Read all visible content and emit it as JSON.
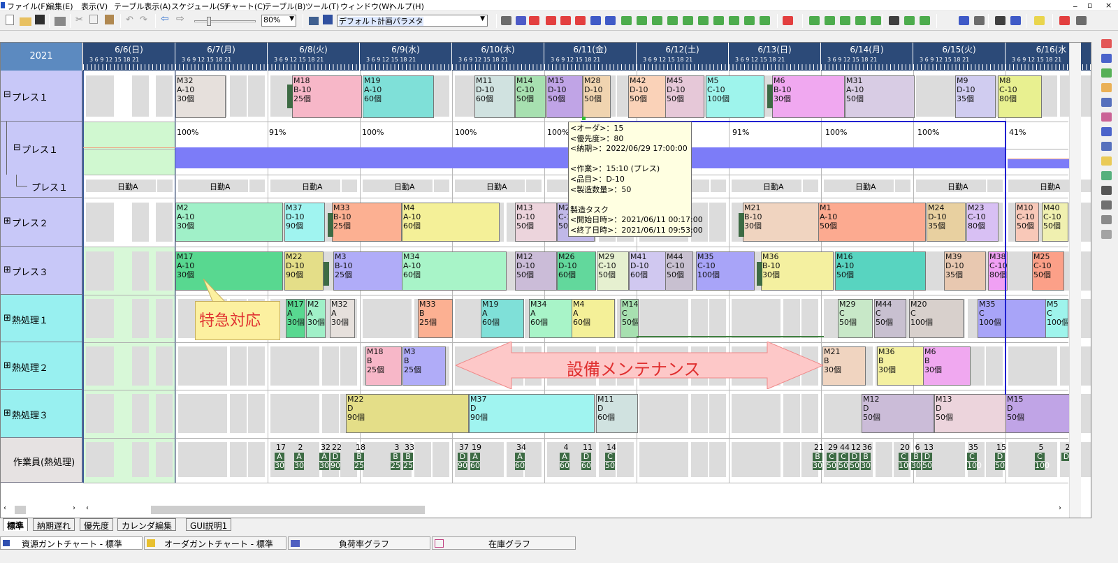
{
  "menu": [
    "ファイル(F)",
    "編集(E)",
    "表示(V)",
    "テーブル表示(A)",
    "スケジュール(S)",
    "チャート(C)",
    "テーブル(B)",
    "ツール(T)",
    "ウィンドウ(W)",
    "ヘルプ(H)"
  ],
  "window_controls": [
    "_",
    "▫",
    "×"
  ],
  "toolbar": {
    "zoom": "80%",
    "param_select": "デフォルト計画パラメタ"
  },
  "chart": {
    "year": "2021",
    "dates": [
      "6/6(日)",
      "6/7(月)",
      "6/8(火)",
      "6/9(水)",
      "6/10(木)",
      "6/11(金)",
      "6/12(土)",
      "6/13(日)",
      "6/14(月)",
      "6/15(火)",
      "6/16(水"
    ],
    "hours": "3  6  9  12  15  18  21",
    "rows": [
      "プレス１",
      "プレス１",
      "プレス１",
      "プレス２",
      "プレス３",
      "熱処理１",
      "熱処理２",
      "熱処理３",
      "作業員(熱処理)"
    ],
    "rows_prefix": [
      "⊟",
      "⊟",
      "",
      "⊞",
      "⊞",
      "⊞",
      "⊞",
      "⊞",
      ""
    ],
    "percents": [
      "100%",
      "91%",
      "100%",
      "100%",
      "100%",
      "91%",
      "100%",
      "100%",
      "41%"
    ],
    "calendar": [
      "日勤A",
      "日勤A",
      "日勤A",
      "日勤A",
      "日勤A",
      "日勤A",
      "日勤A",
      "日勤A",
      "日勤A",
      "日勤A",
      "日勤A"
    ]
  },
  "press1_bars": [
    {
      "t": "M32\nA-10\n30個",
      "c": "#e6e0dc"
    },
    {
      "t": "M18\nB-10\n25個",
      "c": "#f7b7c8"
    },
    {
      "t": "M19\nA-10\n60個",
      "c": "#7fe0d8"
    },
    {
      "t": "M11\nD-10\n60個",
      "c": "#d0e2e0"
    },
    {
      "t": "M14\nC-10\n50個",
      "c": "#a7e0b0"
    },
    {
      "t": "M15\nD-10\n50個",
      "c": "#c0a4e6"
    },
    {
      "t": "M28\nD-10\n50個",
      "c": "#f0d4b0"
    },
    {
      "t": "M42\nD-10\n50個",
      "c": "#fad2b8"
    },
    {
      "t": "M45\nD-10\n50個",
      "c": "#e6c8d8"
    },
    {
      "t": "M5\nC-10\n100個",
      "c": "#9ef4ec"
    },
    {
      "t": "M6\nB-10\n30個",
      "c": "#f0a8f0"
    },
    {
      "t": "M31\nA-10\n50個",
      "c": "#d8cce4"
    },
    {
      "t": "M9\nD-10\n35個",
      "c": "#d0ccf0"
    },
    {
      "t": "M8\nC-10\n80個",
      "c": "#e8f090"
    }
  ],
  "press2_bars": [
    {
      "t": "M2\nA-10\n30個",
      "c": "#a0f0c8"
    },
    {
      "t": "M37\nD-10\n90個",
      "c": "#a0f4f0"
    },
    {
      "t": "M33\nB-10\n25個",
      "c": "#fcb092"
    },
    {
      "t": "M4\nA-10\n60個",
      "c": "#f4f098"
    },
    {
      "t": "M13\nD-10\n50個",
      "c": "#ecd4dc"
    },
    {
      "t": "M27\nC-10\n50個",
      "c": "#c0b8e8"
    },
    {
      "t": "M21\nB-10\n30個",
      "c": "#f0d4c0"
    },
    {
      "t": "M1\nA-10\n50個",
      "c": "#fcaa90"
    },
    {
      "t": "M24\nD-10\n35個",
      "c": "#e8d0a0"
    },
    {
      "t": "M23\nC-10\n80個",
      "c": "#d8c0f4"
    },
    {
      "t": "M10\nC-10\n50個",
      "c": "#f8c8b8"
    },
    {
      "t": "M40\nC-10\n50個",
      "c": "#f0f0b0"
    }
  ],
  "press3_bars": [
    {
      "t": "M17\nA-10\n30個",
      "c": "#58d890"
    },
    {
      "t": "M22\nD-10\n90個",
      "c": "#e4de88"
    },
    {
      "t": "M3\nB-10\n25個",
      "c": "#b0acf8"
    },
    {
      "t": "M34\nA-10\n60個",
      "c": "#a8f4c8"
    },
    {
      "t": "M12\nD-10\n50個",
      "c": "#cbbcd8"
    },
    {
      "t": "M26\nD-10\n60個",
      "c": "#62d89c"
    },
    {
      "t": "M29\nC-10\n50個",
      "c": "#e6f0d0"
    },
    {
      "t": "M41\nD-10\n60個",
      "c": "#d0c8f0"
    },
    {
      "t": "M44\nC-10\n50個",
      "c": "#c8c0d0"
    },
    {
      "t": "M35\nC-10\n100個",
      "c": "#a8a4f8"
    },
    {
      "t": "M36\nB-10\n30個",
      "c": "#f4f0a0"
    },
    {
      "t": "M16\nA-10\n50個",
      "c": "#58d4c0"
    },
    {
      "t": "M39\nD-10\n35個",
      "c": "#e8c8b0"
    },
    {
      "t": "M38\nC-10\n80個",
      "c": "#f0a0f4"
    },
    {
      "t": "M25\nC-10\n50個",
      "c": "#fca088"
    }
  ],
  "heat1_bars": [
    {
      "t": "M17\nA\n30個",
      "c": "#58d890"
    },
    {
      "t": "M2\nA\n30個",
      "c": "#a0f0c8"
    },
    {
      "t": "M32\nA\n30個",
      "c": "#e6e0dc"
    },
    {
      "t": "M33\nB\n25個",
      "c": "#fcb092"
    },
    {
      "t": "M19\nA\n60個",
      "c": "#7fe0d8"
    },
    {
      "t": "M34\nA\n60個",
      "c": "#a8f4c8"
    },
    {
      "t": "M4\nA\n60個",
      "c": "#f4f098"
    },
    {
      "t": "M14\nC\n50個",
      "c": "#a7e0b0"
    },
    {
      "t": "M29\nC\n50個",
      "c": "#c8e8c8"
    },
    {
      "t": "M44\nC\n50個",
      "c": "#c8c0d0"
    },
    {
      "t": "M20\nC\n100個",
      "c": "#d8d0cc"
    },
    {
      "t": "M35\nC\n100個",
      "c": "#a8a4f8"
    },
    {
      "t": "M5\nC\n100個",
      "c": "#9ef4ec"
    }
  ],
  "heat2_bars": [
    {
      "t": "M18\nB\n25個",
      "c": "#f7b7c8"
    },
    {
      "t": "M3\nB\n25個",
      "c": "#b0acf8"
    },
    {
      "t": "M21\nB\n30個",
      "c": "#f0d4c0"
    },
    {
      "t": "M36\nB\n30個",
      "c": "#f4f0a0"
    },
    {
      "t": "M6\nB\n30個",
      "c": "#f0a8f0"
    }
  ],
  "heat3_bars": [
    {
      "t": "M22\nD\n90個",
      "c": "#e4de88"
    },
    {
      "t": "M37\nD\n90個",
      "c": "#a0f4f0"
    },
    {
      "t": "M11\nD\n60個",
      "c": "#d0e2e0"
    },
    {
      "t": "M12\nD\n50個",
      "c": "#cbbcd8"
    },
    {
      "t": "M13\nD\n50個",
      "c": "#ecd4dc"
    },
    {
      "t": "M15\nD\n50個",
      "c": "#c0a4e6"
    }
  ],
  "workers": [
    {
      "n": "17",
      "a": "A",
      "q": "30"
    },
    {
      "n": "2",
      "a": "A",
      "q": "30"
    },
    {
      "n": "32",
      "a": "A",
      "q": "30"
    },
    {
      "n": "22",
      "a": "D",
      "q": "90"
    },
    {
      "n": "18",
      "a": "B",
      "q": "25"
    },
    {
      "n": "3",
      "a": "B",
      "q": "25"
    },
    {
      "n": "33",
      "a": "B",
      "q": "25"
    },
    {
      "n": "37",
      "a": "D",
      "q": "90"
    },
    {
      "n": "19",
      "a": "A",
      "q": "60"
    },
    {
      "n": "34",
      "a": "A",
      "q": "60"
    },
    {
      "n": "4",
      "a": "A",
      "q": "60"
    },
    {
      "n": "11",
      "a": "D",
      "q": "60"
    },
    {
      "n": "14",
      "a": "C",
      "q": "50"
    },
    {
      "n": "21",
      "a": "B",
      "q": "30"
    },
    {
      "n": "29",
      "a": "C",
      "q": "50"
    },
    {
      "n": "44",
      "a": "C",
      "q": "50"
    },
    {
      "n": "12",
      "a": "D",
      "q": "50"
    },
    {
      "n": "36",
      "a": "B",
      "q": "30"
    },
    {
      "n": "20",
      "a": "C",
      "q": "100"
    },
    {
      "n": "6",
      "a": "B",
      "q": "30"
    },
    {
      "n": "13",
      "a": "D",
      "q": "50"
    },
    {
      "n": "35",
      "a": "C",
      "q": "100"
    },
    {
      "n": "15",
      "a": "D",
      "q": "50"
    },
    {
      "n": "5",
      "a": "C",
      "q": "100"
    },
    {
      "n": "2",
      "a": "D",
      "q": ""
    }
  ],
  "tooltip": [
    "<オーダ>：15",
    "<優先度>：80",
    "<納期>：2022/06/29 17:00:00",
    "",
    "<作業>：15:10 (プレス)",
    "<品目>：D-10",
    "<製造数量>：50",
    "",
    "製造タスク",
    "<開始日時>：2021/06/11 00:17:00",
    "<終了日時>：2021/06/11 09:53:00"
  ],
  "callout": "特急対応",
  "maintenance": "設備メンテナンス",
  "sheet_tabs": [
    "標準",
    "納期遅れ",
    "優先度",
    "カレンダ編集",
    "GUI説明1"
  ],
  "window_tabs": [
    "資源ガントチャート - 標準",
    "オーダガントチャート - 標準",
    "負荷率グラフ",
    "在庫グラフ"
  ]
}
